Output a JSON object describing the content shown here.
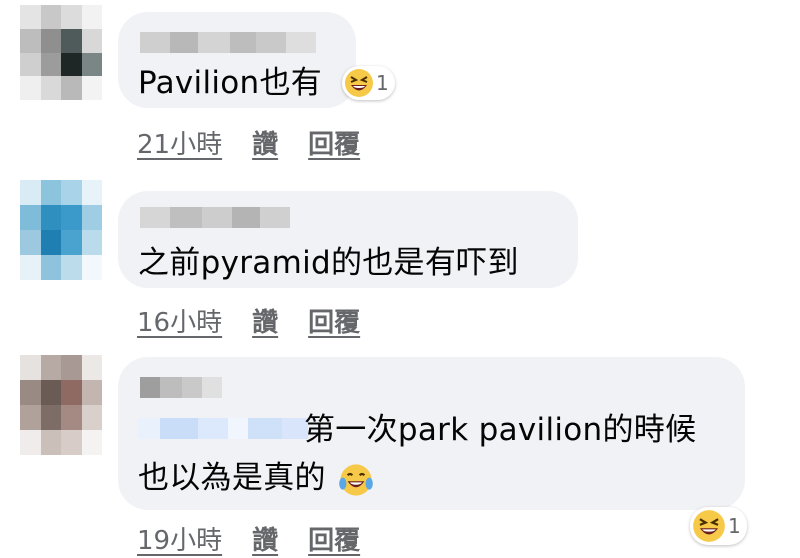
{
  "comments": [
    {
      "text": "Pavilion也有",
      "time": "21小時",
      "like_label": "讚",
      "reply_label": "回覆",
      "reaction": {
        "icon": "laughing-emoji-icon",
        "count": "1"
      }
    },
    {
      "text": "之前pyramid的也是有吓到",
      "time": "16小時",
      "like_label": "讚",
      "reply_label": "回覆"
    },
    {
      "line1": "第一次park pavilion的時候",
      "line2": "也以為是真的",
      "inline_emoji": "tears-of-joy-emoji-icon",
      "time": "19小時",
      "like_label": "讚",
      "reply_label": "回覆",
      "reaction": {
        "icon": "laughing-emoji-icon",
        "count": "1"
      }
    }
  ],
  "colors": {
    "bubble": "#f0f2f5",
    "meta_text": "#65676b",
    "mention_highlight": "#e7f0fd"
  }
}
